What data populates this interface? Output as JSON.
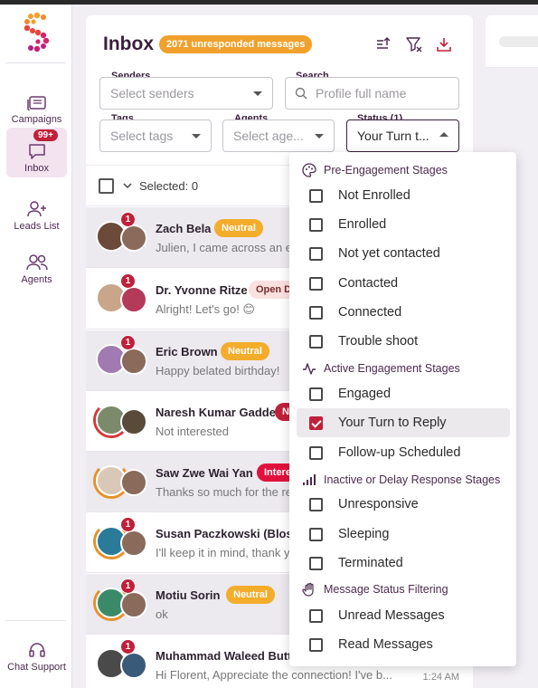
{
  "sidebar": {
    "items": [
      {
        "label": "Campaigns",
        "icon": "campaigns-icon"
      },
      {
        "label": "Inbox",
        "icon": "inbox-icon",
        "badge": "99+"
      },
      {
        "label": "Leads List",
        "icon": "add-user-icon"
      },
      {
        "label": "Agents",
        "icon": "agents-icon"
      },
      {
        "label": "Chat Support",
        "icon": "headset-icon"
      }
    ]
  },
  "inbox": {
    "title": "Inbox",
    "unresponded": "2071 unresponded messages",
    "filters": {
      "senders_label": "Senders",
      "senders_placeholder": "Select senders",
      "search_label": "Search",
      "search_placeholder": "Profile full name",
      "tags_label": "Tags",
      "tags_placeholder": "Select tags",
      "agents_label": "Agents",
      "agents_placeholder": "Select age...",
      "status_label": "Status (1)",
      "status_value": "Your Turn t..."
    },
    "selected_text": "Selected: 0",
    "conversations": [
      {
        "name": "Zach Bela",
        "tag": "Neutral",
        "preview": "Julien, I came across an ex",
        "unread": "1",
        "time": ""
      },
      {
        "name": "Dr. Yvonne Ritze",
        "tag": "Open D",
        "preview": "Alright! Let's go! 😊",
        "unread": "1",
        "time": ""
      },
      {
        "name": "Eric Brown",
        "tag": "Neutral",
        "preview": "Happy belated birthday!",
        "unread": "1",
        "time": ""
      },
      {
        "name": "Naresh Kumar Gadde",
        "tag": "N",
        "preview": "Not interested",
        "unread": "",
        "time": ""
      },
      {
        "name": "Saw Zwe Wai Yan",
        "tag": "Intere",
        "preview": "Thanks so much for the re",
        "unread": "",
        "time": ""
      },
      {
        "name": "Susan Paczkowski (Blosse",
        "tag": "",
        "preview": "I'll keep it in mind, thank y",
        "unread": "1",
        "time": ""
      },
      {
        "name": "Motiu Sorin",
        "tag": "Neutral",
        "preview": "ok",
        "unread": "1",
        "time": ""
      },
      {
        "name": "Muhammad Waleed Butt",
        "tag": "",
        "preview": "Hi Florent, Appreciate the connection! I've b...",
        "unread": "1",
        "time": "1:24 AM"
      }
    ]
  },
  "status_dropdown": {
    "groups": [
      {
        "title": "Pre-Engagement Stages",
        "icon": "palette-icon",
        "options": [
          "Not Enrolled",
          "Enrolled",
          "Not yet contacted",
          "Contacted",
          "Connected",
          "Trouble shoot"
        ]
      },
      {
        "title": "Active Engagement Stages",
        "icon": "activity-icon",
        "options": [
          "Engaged",
          "Your Turn to Reply",
          "Follow-up Scheduled"
        ]
      },
      {
        "title": "Inactive or Delay Response Stages",
        "icon": "signal-bars-icon",
        "options": [
          "Unresponsive",
          "Sleeping",
          "Terminated"
        ]
      },
      {
        "title": "Message Status Filtering",
        "icon": "hand-pointer-icon",
        "options": [
          "Unread Messages",
          "Read Messages"
        ]
      }
    ],
    "checked": "Your Turn to Reply"
  },
  "colors": {
    "accent": "#c0203a",
    "brand_dark": "#3a1f3c",
    "badge_orange": "#f0a12c"
  }
}
